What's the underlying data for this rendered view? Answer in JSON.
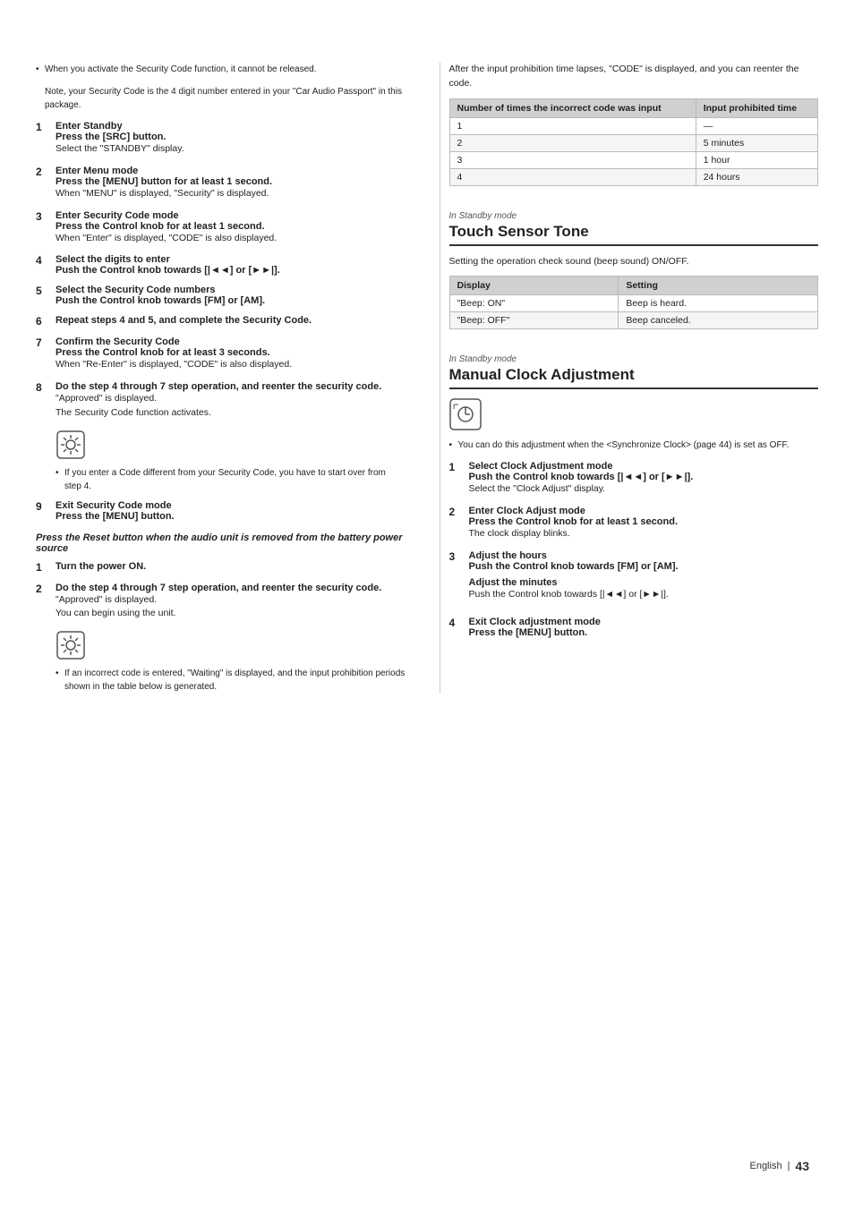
{
  "page": {
    "language": "English",
    "page_number": "43",
    "corner_marks": true
  },
  "left_col": {
    "intro_bullet": "When you activate the Security Code function, it cannot be released.",
    "intro_sub": "Note, your Security Code is the 4 digit number entered in your \"Car Audio Passport\" in this package.",
    "steps": [
      {
        "num": "1",
        "title": "Enter Standby",
        "detail": "Press the [SRC] button.",
        "body": "Select the \"STANDBY\" display."
      },
      {
        "num": "2",
        "title": "Enter Menu mode",
        "detail": "Press the [MENU] button for at least 1 second.",
        "body": "When \"MENU\" is displayed, \"Security\" is displayed."
      },
      {
        "num": "3",
        "title": "Enter Security Code mode",
        "detail": "Press the Control knob for at least 1 second.",
        "body": "When \"Enter\" is displayed, \"CODE\" is also displayed."
      },
      {
        "num": "4",
        "title": "Select the digits to enter",
        "detail": "Push the Control knob towards [|◄◄] or [►►|].",
        "body": ""
      },
      {
        "num": "5",
        "title": "Select the Security Code numbers",
        "detail": "Push the Control knob towards [FM] or [AM].",
        "body": ""
      },
      {
        "num": "6",
        "title": "Repeat steps 4 and 5, and complete the Security Code.",
        "detail": "",
        "body": ""
      },
      {
        "num": "7",
        "title": "Confirm the Security Code",
        "detail": "Press the Control knob for at least 3 seconds.",
        "body": "When \"Re-Enter\" is displayed, \"CODE\" is also displayed."
      },
      {
        "num": "8",
        "title": "Do the step 4 through 7 step operation, and reenter the security code.",
        "detail": "",
        "body": "\"Approved\" is displayed.\nThe Security Code function activates."
      },
      {
        "num": "8",
        "type": "note",
        "body": "If you enter a Code different from your Security Code, you have to start over from step 4."
      },
      {
        "num": "9",
        "title": "Exit Security Code mode",
        "detail": "Press the [MENU] button.",
        "body": ""
      }
    ],
    "reset_section": {
      "heading": "Press the Reset button when the audio unit is removed from the battery power source",
      "steps": [
        {
          "num": "1",
          "title": "Turn the power ON.",
          "body": ""
        },
        {
          "num": "2",
          "title": "Do the step 4 through 7 step operation, and reenter the security code.",
          "body": "\"Approved\" is displayed.\nYou can begin using the unit."
        }
      ],
      "note": "If an incorrect code is entered, \"Waiting\" is displayed, and the input prohibition periods shown in the table below is generated."
    }
  },
  "right_col": {
    "table_intro": "After the input prohibition time lapses, \"CODE\" is displayed, and you can reenter the code.",
    "table": {
      "headers": [
        "Number of times the incorrect code was input",
        "Input prohibited time"
      ],
      "rows": [
        [
          "1",
          "—"
        ],
        [
          "2",
          "5 minutes"
        ],
        [
          "3",
          "1 hour"
        ],
        [
          "4",
          "24 hours"
        ]
      ]
    },
    "touch_sensor": {
      "mode": "In Standby mode",
      "title": "Touch Sensor Tone",
      "desc": "Setting the operation check sound (beep sound) ON/OFF.",
      "table": {
        "headers": [
          "Display",
          "Setting"
        ],
        "rows": [
          [
            "\"Beep: ON\"",
            "Beep is heard."
          ],
          [
            "\"Beep: OFF\"",
            "Beep canceled."
          ]
        ]
      }
    },
    "clock": {
      "mode": "In Standby mode",
      "title": "Manual Clock Adjustment",
      "note": "You can do this adjustment when the <Synchronize Clock> (page 44) is set as OFF.",
      "steps": [
        {
          "num": "1",
          "title": "Select Clock Adjustment mode",
          "detail": "Push the Control knob towards [|◄◄] or [►►|].",
          "body": "Select the \"Clock Adjust\" display."
        },
        {
          "num": "2",
          "title": "Enter Clock Adjust mode",
          "detail": "Press the Control knob for at least 1 second.",
          "body": "The clock display blinks."
        },
        {
          "num": "3",
          "title": "Adjust the hours",
          "detail": "Push the Control knob towards [FM] or [AM].",
          "body": "",
          "sub": {
            "title": "Adjust the minutes",
            "detail": "Push the Control knob towards [|◄◄] or [►►|]."
          }
        },
        {
          "num": "4",
          "title": "Exit Clock adjustment mode",
          "detail": "Press the [MENU] button.",
          "body": ""
        }
      ]
    }
  }
}
